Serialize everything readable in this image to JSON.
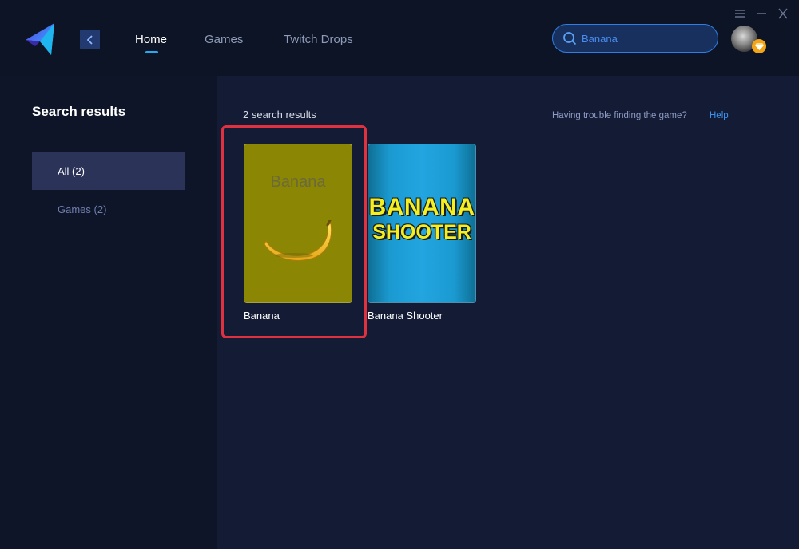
{
  "nav": {
    "home": "Home",
    "games": "Games",
    "twitch_drops": "Twitch Drops"
  },
  "search": {
    "value": "Banana"
  },
  "sidebar": {
    "title": "Search results",
    "filters": [
      {
        "label": "All (2)",
        "active": true
      },
      {
        "label": "Games (2)",
        "active": false
      }
    ]
  },
  "main": {
    "result_count": "2 search results",
    "help_prompt": "Having trouble finding the game?",
    "help_link": "Help",
    "results": [
      {
        "title": "Banana",
        "cover_text": "Banana",
        "cover_color": "#8b8604"
      },
      {
        "title": "Banana Shooter",
        "cover_line1": "BANANA",
        "cover_line2": "SHOOTER",
        "cover_color": "#22a5e0"
      }
    ]
  },
  "colors": {
    "accent": "#27a8f0",
    "highlight": "#e03140",
    "badge": "#f2a516"
  }
}
